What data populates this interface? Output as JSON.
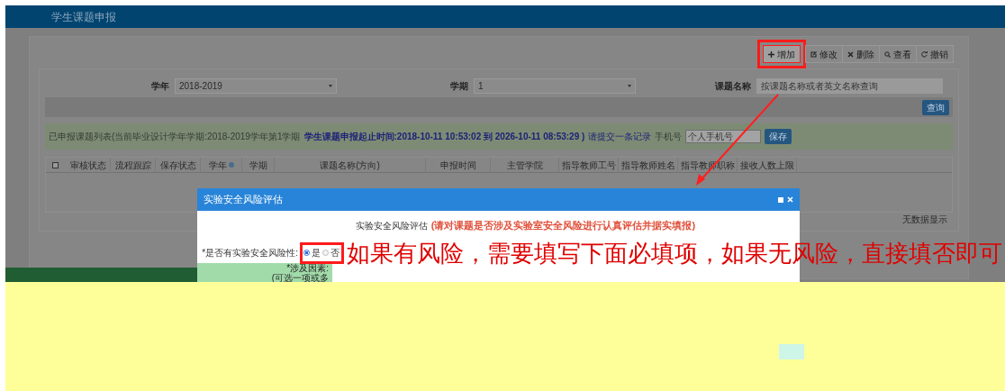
{
  "header": {
    "title": "学生课题申报"
  },
  "toolbar": {
    "buttons": [
      {
        "label": "增加",
        "highlighted": true
      },
      {
        "label": "修改",
        "highlighted": false
      },
      {
        "label": "删除",
        "highlighted": false
      },
      {
        "label": "查看",
        "highlighted": false
      },
      {
        "label": "撤销",
        "highlighted": false
      }
    ]
  },
  "filters": [
    {
      "kind": "select",
      "label": "学年",
      "value": "2018-2019"
    },
    {
      "kind": "select",
      "label": "学期",
      "value": "1"
    },
    {
      "kind": "input",
      "label": "课题名称",
      "placeholder": "按课题名称或者英文名称查询"
    }
  ],
  "search_button": "查询",
  "notice": {
    "text": "已申报课题列表(当前毕业设计学年学期:2018-2019学年第1学期",
    "deadline": "学生课题申报起止时间:2018-10-11 10:53:02 到 2026-10-11 08:53:29 )",
    "submit_note": "请提交一条记录",
    "phone_label": "手机号",
    "phone_placeholder": "个人手机号",
    "save_button": "保存"
  },
  "table": {
    "select_all_checked": false,
    "columns": [
      {
        "label": "审核状态",
        "sortable": false
      },
      {
        "label": "流程跟踪",
        "sortable": false
      },
      {
        "label": "保存状态",
        "sortable": false
      },
      {
        "label": "学年",
        "sortable": true
      },
      {
        "label": "学期",
        "sortable": false
      },
      {
        "label": "课题名称(方向)",
        "sortable": false
      },
      {
        "label": "申报时间",
        "sortable": false
      },
      {
        "label": "主管学院",
        "sortable": false
      },
      {
        "label": "指导教师工号",
        "sortable": false
      },
      {
        "label": "指导教师姓名",
        "sortable": false
      },
      {
        "label": "指导教师职称",
        "sortable": false
      },
      {
        "label": "接收人数上限",
        "sortable": false
      }
    ],
    "empty_text": "无数据显示"
  },
  "modal": {
    "title": "实验安全风险评估",
    "subtitle": "实验安全风险评估",
    "subtitle_note": "(请对课题是否涉及实验室安全风险进行认真评估并据实填报)",
    "risk_question": "*是否有实验安全风险性:",
    "options": [
      {
        "label": "是",
        "selected": true
      },
      {
        "label": "否",
        "selected": false
      }
    ],
    "factors_label": "*涉及因素:",
    "factors_hint": "(可选一项或多"
  },
  "annotation": {
    "text": "如果有风险，需要填写下面必填项，如果无风险，直接填否即可"
  }
}
